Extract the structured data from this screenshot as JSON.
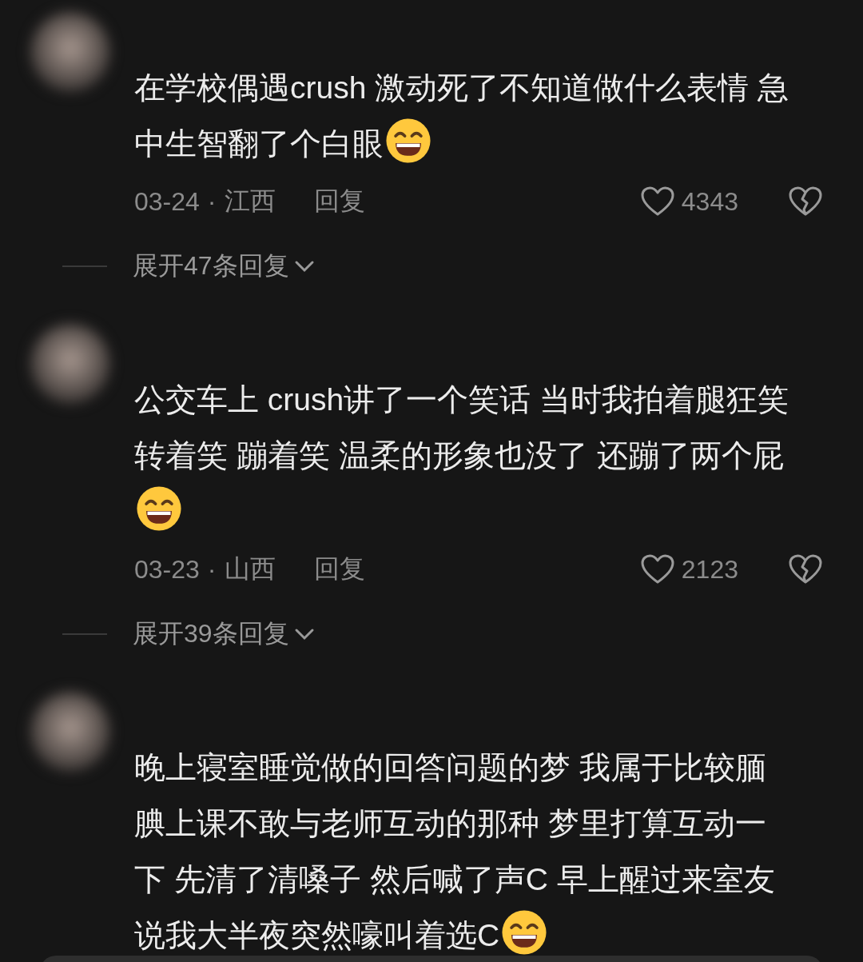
{
  "comments": [
    {
      "lines": [
        {
          "text": "在学校偶遇crush 激动死了不知道做什么表情 急",
          "emoji": false
        },
        {
          "text": "中生智翻了个白眼",
          "emoji": true
        }
      ],
      "date": "03-24",
      "separator": "·",
      "region": "江西",
      "reply_label": "回复",
      "likes": "4343",
      "more_replies": "展开47条回复"
    },
    {
      "lines": [
        {
          "text": "公交车上 crush讲了一个笑话 当时我拍着腿狂笑",
          "emoji": false
        },
        {
          "text": "转着笑 蹦着笑 温柔的形象也没了 还蹦了两个屁",
          "emoji": false
        },
        {
          "emoji": true
        }
      ],
      "date": "03-23",
      "separator": "·",
      "region": "山西",
      "reply_label": "回复",
      "likes": "2123",
      "more_replies": "展开39条回复"
    },
    {
      "lines": [
        {
          "text": "晚上寝室睡觉做的回答问题的梦 我属于比较腼",
          "emoji": false
        },
        {
          "text": "腆上课不敢与老师互动的那种 梦里打算互动一",
          "emoji": false
        },
        {
          "text": "下 先清了清嗓子 然后喊了声C 早上醒过来室友",
          "emoji": false
        },
        {
          "text": "说我大半夜突然嚎叫着选C",
          "emoji": true
        }
      ]
    }
  ]
}
